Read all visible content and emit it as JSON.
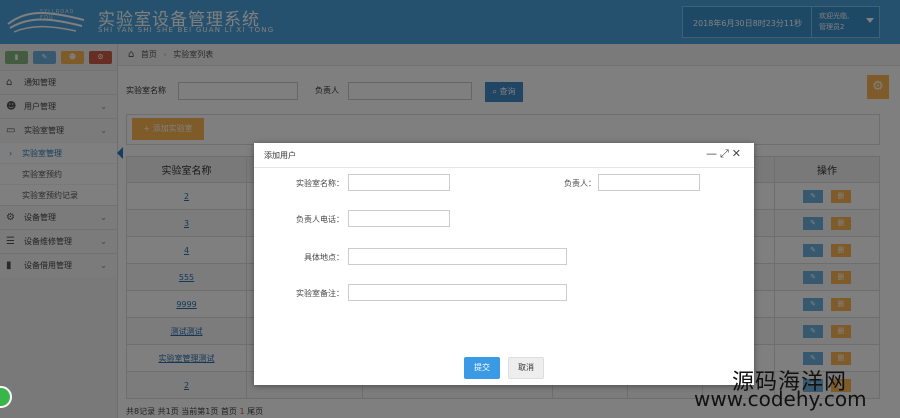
{
  "header": {
    "logo_text": "SYLLROAD EDU",
    "title": "实验室设备管理系统",
    "subtitle": "SHI YAN SHI SHE BEI GUAN LI XI TONG",
    "datetime": "2018年6月30日8时23分11秒",
    "welcome": "欢迎光临,",
    "username": "管理员2"
  },
  "sidebar": {
    "shortcuts": [
      "chart-icon",
      "pencil-icon",
      "users-icon",
      "cogs-icon"
    ],
    "items": [
      {
        "label": "通知管理",
        "icon": "home-icon"
      },
      {
        "label": "用户管理",
        "icon": "users-icon"
      },
      {
        "label": "实验室管理",
        "icon": "monitor-icon"
      },
      {
        "label": "设备管理",
        "icon": "cogs-icon"
      },
      {
        "label": "设备维修管理",
        "icon": "list-icon"
      },
      {
        "label": "设备借用管理",
        "icon": "bookmark-icon"
      }
    ],
    "submenu": [
      "实验室管理",
      "实验室预约",
      "实验室预约记录"
    ]
  },
  "breadcrumb": {
    "home": "首页",
    "current": "实验室列表"
  },
  "search": {
    "name_label": "实验室名称",
    "owner_label": "负责人",
    "query_button": "查询"
  },
  "toolbar": {
    "add_button": "添加实验室"
  },
  "table": {
    "headers": [
      "实验室名称",
      "操作"
    ],
    "rows": [
      "2",
      "3",
      "4",
      "555",
      "9999",
      "测试测试",
      "实验室管理测试",
      "2"
    ],
    "edit_label": "✎",
    "delete_label": "删"
  },
  "pager": {
    "text": "共8记录 共1页 当前第1页 首页",
    "current": "1",
    "tail": "尾页"
  },
  "modal": {
    "title": "添加用户",
    "fields": {
      "name": "实验室名称：",
      "owner": "负责人：",
      "phone": "负责人电话：",
      "address": "具体地点：",
      "note": "实验室备注："
    },
    "submit": "提交",
    "cancel": "取消"
  },
  "watermark": {
    "line1": "源码海洋网",
    "line2": "www.codehy.com"
  }
}
